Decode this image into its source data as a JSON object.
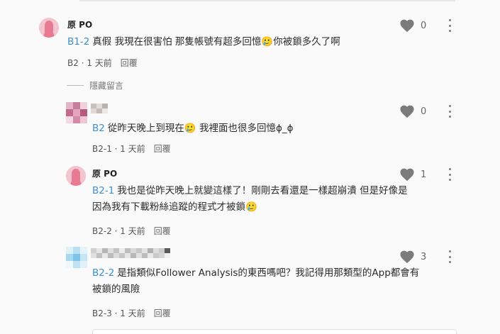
{
  "colors": {
    "accent": "#3d8fd1",
    "heart": "#7b7b7b",
    "po_avatar": "#e97a93"
  },
  "comments": [
    {
      "author": "原 PO",
      "tag": "B1-2",
      "text": "真假 我現在很害怕 那隻帳號有超多回憶🥲你被鎖多久了啊",
      "floor": "B2",
      "time": "1 天前",
      "reply": "回覆",
      "likes": "0"
    },
    {
      "author": "",
      "tag": "B2",
      "text": "從昨天晚上到現在🥲 我裡面也很多回憶ɸ_ɸ",
      "floor": "B2-1",
      "time": "1 天前",
      "reply": "回覆",
      "likes": "0"
    },
    {
      "author": "原 PO",
      "tag": "B2-1",
      "text_line1": "我也是從昨天晚上就變這樣了！剛剛去看還是一樣超崩潰 但是好像是",
      "text_line2": "因為我有下載粉絲追蹤的程式才被鎖🥲",
      "floor": "B2-2",
      "time": "1 天前",
      "reply": "回覆",
      "likes": "1"
    },
    {
      "author": "",
      "tag": "B2-2",
      "text_line1": "是指類似Follower Analysis的東西嗎吧？我記得用那類型的App都會有",
      "text_line2": "被鎖的風險",
      "floor": "B2-3",
      "time": "1 天前",
      "reply": "回覆",
      "likes": "3"
    }
  ],
  "hidden_replies_label": "隱藏留言",
  "icons": {
    "like": "heart-icon",
    "more": "more-vertical-icon",
    "avatar": "female-silhouette-icon"
  }
}
